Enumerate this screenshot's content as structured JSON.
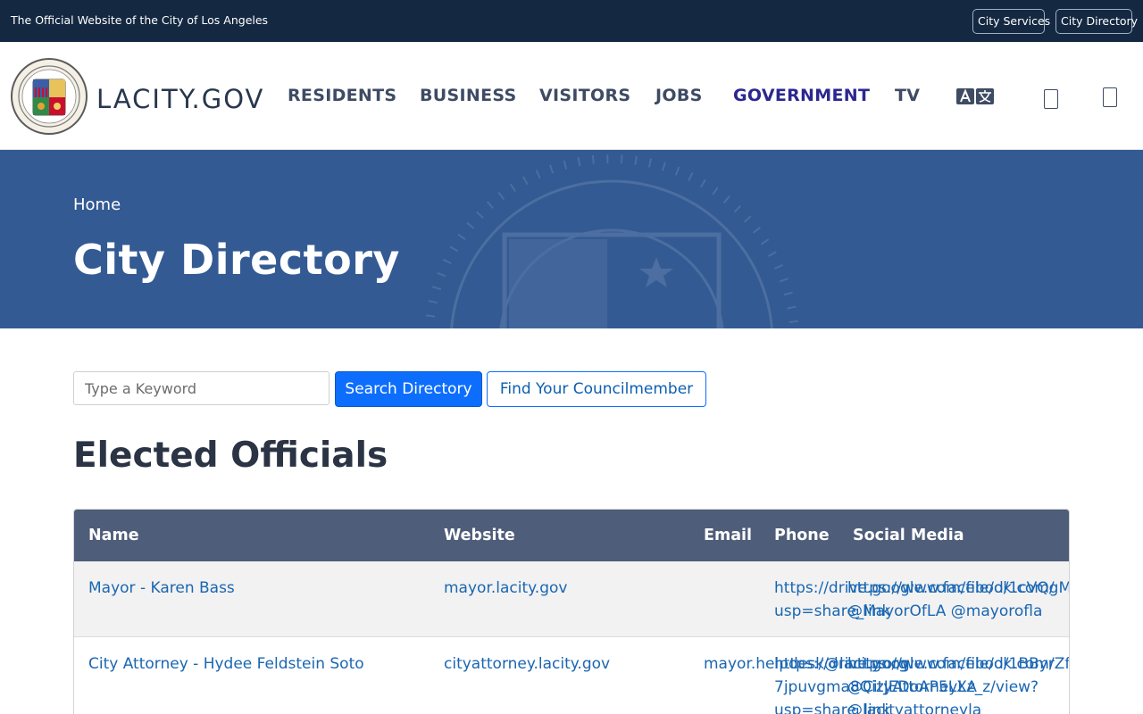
{
  "topbar": {
    "official_text": "The Official Website of the City of Los Angeles",
    "city_services": "City Services",
    "city_directory": "City Directory"
  },
  "header": {
    "logo_text": "LACITY.GOV",
    "nav": [
      "RESIDENTS",
      "BUSINESS",
      "VISITORS",
      "JOBS",
      "GOVERNMENT",
      "TV"
    ],
    "active_nav": "GOVERNMENT",
    "icons": [
      "translate-icon",
      "search-icon",
      "menu-icon"
    ]
  },
  "hero": {
    "breadcrumb": "Home",
    "title": "City Directory"
  },
  "search": {
    "placeholder": "Type a Keyword",
    "search_button": "Search Directory",
    "council_button": "Find Your Councilmember"
  },
  "section": {
    "heading": "Elected Officials"
  },
  "table": {
    "headers": [
      "Name",
      "Website",
      "Email",
      "Phone",
      "Social Media"
    ],
    "rows": [
      {
        "name": "Mayor - Karen Bass",
        "website": "mayor.lacity.gov",
        "email": "",
        "phone_line1": "https://drive.google.com/file/d/1cVQgM",
        "phone_line2": "usp=share_link",
        "social_line1": "https://www.facebook.com/",
        "social_line2": "@MayorOfLA @mayorofla"
      },
      {
        "name": "City Attorney - Hydee Feldstein Soto",
        "website": "cityattorney.lacity.gov",
        "email": "mayor.helpdesk@lacity.org",
        "phone_line1": "https://drive.google.com/file/d/1BByrZf",
        "phone_line2": "7jpuvgma8QizJEDoAP5LXz_z/view?",
        "phone_line3": "usp=share_link",
        "social_line1": "https://www.facebook.com/",
        "social_line2": "@CityAttorneyLA",
        "social_line3": "@lacityattorneyla"
      }
    ]
  },
  "colors": {
    "topbar": "#142841",
    "hero": "#335a93",
    "table_header": "#4e5d79",
    "link": "#1a66b2",
    "primary_button": "#0d6efd",
    "active_nav": "#2c2790"
  }
}
